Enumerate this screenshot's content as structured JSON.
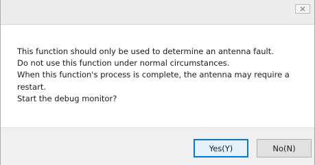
{
  "dialog": {
    "title": "",
    "close_icon": "close-icon",
    "message_lines": [
      "This function should only be used to determine an antenna fault.",
      "Do not use this function under normal circumstances.",
      "When this function's process is complete, the antenna may require a",
      "restart.",
      "Start the debug monitor?"
    ],
    "buttons": {
      "yes_label": "Yes(Y)",
      "no_label": "No(N)"
    }
  },
  "colors": {
    "titlebar": "#ededed",
    "footer": "#f0f0f0",
    "button_face": "#e1e1e1",
    "default_button_border": "#0078d7"
  }
}
